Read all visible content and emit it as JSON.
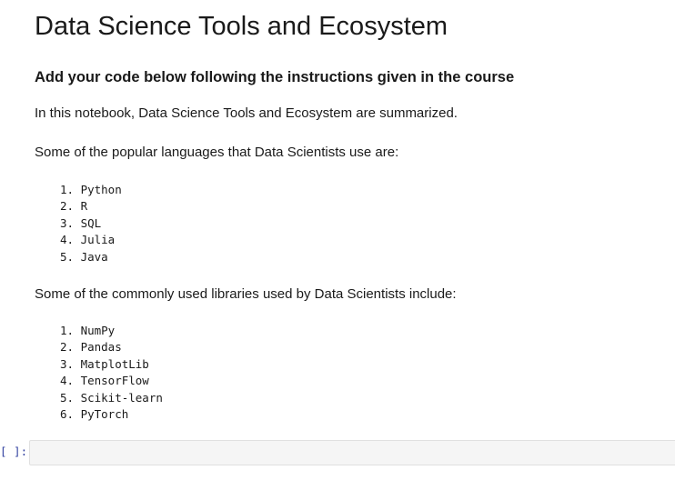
{
  "notebook": {
    "title": "Data Science Tools and Ecosystem",
    "subtitle": "Add your code below following the instructions given in the course",
    "intro_text": "In this notebook, Data Science Tools and Ecosystem are summarized.",
    "languages_intro": "Some of the popular languages that Data Scientists use are:",
    "languages": [
      "1. Python",
      "2. R",
      "3. SQL",
      "4. Julia",
      "5. Java"
    ],
    "libraries_intro": "Some of the commonly used libraries used by Data Scientists include:",
    "libraries": [
      "1. NumPy",
      "2. Pandas",
      "3. MatplotLib",
      "4. TensorFlow",
      "5. Scikit-learn",
      "6. PyTorch"
    ]
  },
  "code_cell": {
    "prompt": "[ ]:"
  },
  "colors": {
    "prompt": "#303f9f",
    "code_background": "#f5f5f5",
    "code_border": "#e0e0e0",
    "text": "#1a1a1a"
  }
}
